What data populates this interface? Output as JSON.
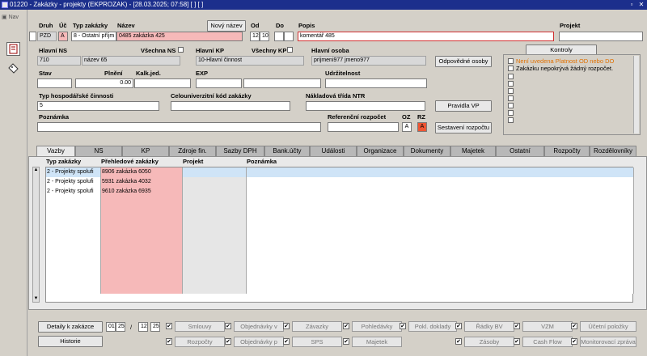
{
  "window": {
    "title": "01220 - Zakázky - projekty (EKPROZAK) - [28.03.2025; 07:58] [ ] [ ]",
    "btn_restore": "▫",
    "btn_close": "✕"
  },
  "nav": {
    "label": "Nav"
  },
  "form": {
    "druh_label": "Druh",
    "druh_value": "PZD",
    "uc_label": "Úč",
    "uc_value": "A",
    "typ_label": "Typ zakázky",
    "typ_value": "8 - Ostatní příjm",
    "nazev_label": "Název",
    "nazev_value": "0485 zakázka 425",
    "novy_nazev": "Nový název",
    "od_label": "Od",
    "od_value1": "12",
    "od_value2": "10",
    "do_label": "Do",
    "popis_label": "Popis",
    "popis_value": "komentář 485",
    "projekt_label": "Projekt",
    "hlavni_ns_label": "Hlavní NS",
    "hlavni_ns_code": "710",
    "hlavni_ns_name": "název 65",
    "vsechna_ns": "Všechna NS",
    "hlavni_kp_label": "Hlavní KP",
    "hlavni_kp_value": "10-Hlavní činnost",
    "vsechny_kp": "Všechny KP",
    "hlavni_osoba_label": "Hlavní osoba",
    "hlavni_osoba_value": "prijmeni977 jmeno977",
    "odpovedne_osoby": "Odpovědné osoby",
    "stav_label": "Stav",
    "plneni_label": "Plnění",
    "plneni_value": "0.00",
    "kalk_label": "Kalk.jed.",
    "exp_label": "EXP",
    "udrzitelnost_label": "Udržitelnost",
    "typ_hosp_label": "Typ hospodářské činnosti",
    "typ_hosp_value": "5",
    "celouniv_label": "Celouniverzitní kód zakázky",
    "nakladova_label": "Nákladová třída NTR",
    "pravidla_vp": "Pravidla VP",
    "poznamka_label": "Poznámka",
    "referencni_label": "Referenční rozpočet",
    "oz_label": "OZ",
    "oz_value": "A",
    "rz_label": "RZ",
    "rz_value": "A",
    "sestaveni": "Sestavení rozpočtu"
  },
  "kontroly": {
    "button": "Kontroly",
    "items": [
      "Není uvedena Platnost OD nebo DO",
      "Zakázku nepokrývá žádný rozpočet."
    ],
    "accent_warning": "#e07000"
  },
  "tabs": [
    "Vazby",
    "NS",
    "KP",
    "Zdroje fin.",
    "Sazby DPH",
    "Bank.účty",
    "Události",
    "Organizace",
    "Dokumenty",
    "Majetek",
    "Ostatní",
    "Rozpočty",
    "Rozdělovníky"
  ],
  "grid": {
    "headers": [
      "Typ zakázky",
      "Přehledové zakázky",
      "Projekt",
      "Poznámka"
    ],
    "rows": [
      [
        "2 - Projekty spolufi",
        "8906 zakázka 6050",
        "",
        ""
      ],
      [
        "2 - Projekty spolufi",
        "5931 zakázka 4032",
        "",
        ""
      ],
      [
        "2 - Projekty spolufi",
        "9610 zakázka 6935",
        "",
        ""
      ]
    ],
    "empty_rows": 10
  },
  "bottom": {
    "detaily": "Detaily k zakázce",
    "date1a": "01",
    "date1b": "25",
    "date_sep": "/",
    "date2a": "12",
    "date2b": "25",
    "historie": "Historie",
    "row1": [
      "Smlouvy",
      "Objednávky v",
      "Závazky",
      "Pohledávky",
      "Pokl. doklady",
      "Řádky BV",
      "VZM",
      "Účetní položky"
    ],
    "row2": [
      "Rozpočty",
      "Objednávky p",
      "SPS",
      "Majetek",
      "Zásoby",
      "Cash Flow",
      "Monitorovací zpráva"
    ],
    "check": "✔"
  }
}
